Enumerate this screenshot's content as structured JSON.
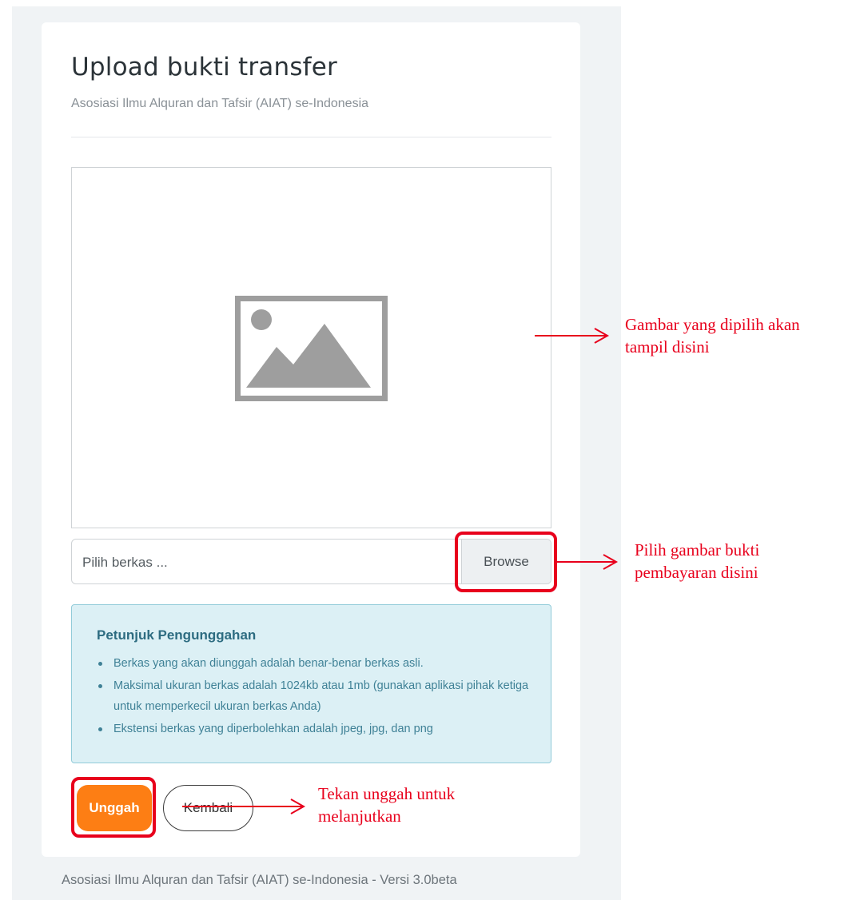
{
  "page": {
    "title": "Upload bukti transfer",
    "subtitle": "Asosiasi Ilmu Alquran dan Tafsir (AIAT) se-Indonesia"
  },
  "preview": {
    "icon": "image-placeholder-icon"
  },
  "file_input": {
    "placeholder": "Pilih berkas ...",
    "browse_label": "Browse"
  },
  "instructions": {
    "title": "Petunjuk Pengunggahan",
    "items": [
      "Berkas yang akan diunggah adalah benar-benar berkas asli.",
      "Maksimal ukuran berkas adalah 1024kb atau 1mb (gunakan aplikasi pihak ketiga untuk memperkecil ukuran berkas Anda)",
      "Ekstensi berkas yang diperbolehkan adalah jpeg, jpg, dan png"
    ]
  },
  "actions": {
    "upload_label": "Unggah",
    "back_label": "Kembali"
  },
  "footer": {
    "text": "Asosiasi Ilmu Alquran dan Tafsir (AIAT) se-Indonesia - Versi 3.0beta"
  },
  "annotations": {
    "preview_note_line1": "Gambar yang dipilih akan",
    "preview_note_line2": "tampil disini",
    "browse_note_line1": "Pilih gambar bukti",
    "browse_note_line2": "pembayaran disini",
    "upload_note_line1": "Tekan unggah untuk",
    "upload_note_line2": "melanjutkan"
  },
  "colors": {
    "accent": "#fd7e14",
    "annotation": "#e8001c",
    "info_bg": "#dcf0f5",
    "info_text": "#3f8196"
  }
}
